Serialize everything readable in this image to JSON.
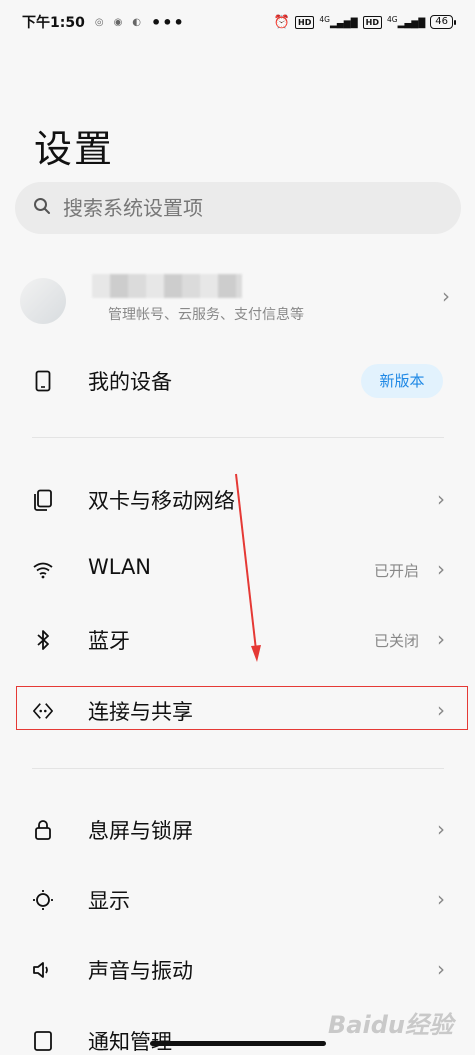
{
  "status_bar": {
    "time": "下午1:50",
    "indicator_dots": "•••",
    "network_left": "4G",
    "hd_left": "HD",
    "network_right": "4G",
    "hd_right": "HD",
    "battery": "46"
  },
  "page": {
    "title": "设置"
  },
  "search": {
    "placeholder": "搜索系统设置项"
  },
  "account": {
    "subtitle": "管理帐号、云服务、支付信息等"
  },
  "items": [
    {
      "label": "我的设备",
      "badge": "新版本",
      "icon": "phone-icon"
    },
    {
      "label": "双卡与移动网络",
      "icon": "sim-card-icon"
    },
    {
      "label": "WLAN",
      "status": "已开启",
      "icon": "wifi-icon"
    },
    {
      "label": "蓝牙",
      "status": "已关闭",
      "icon": "bluetooth-icon"
    },
    {
      "label": "连接与共享",
      "icon": "connection-share-icon"
    },
    {
      "label": "息屏与锁屏",
      "icon": "lock-icon"
    },
    {
      "label": "显示",
      "icon": "brightness-icon"
    },
    {
      "label": "声音与振动",
      "icon": "speaker-icon"
    },
    {
      "label": "通知管理",
      "icon": "notification-icon"
    }
  ],
  "annotation": {
    "color": "#e53935"
  },
  "watermark": "Baidu经验"
}
